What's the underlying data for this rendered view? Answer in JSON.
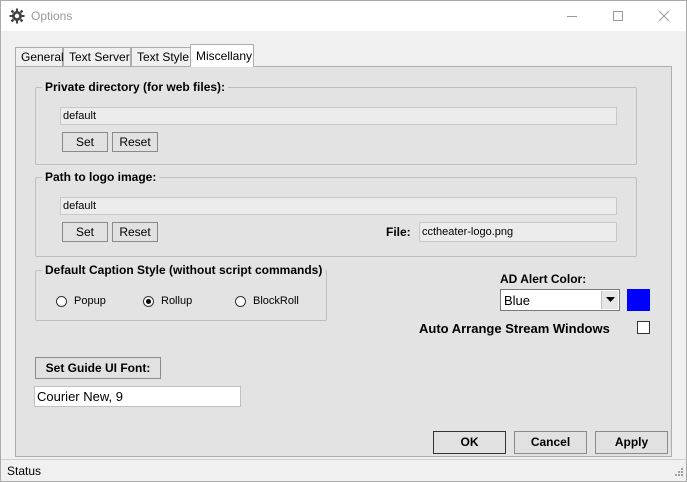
{
  "window": {
    "title": "Options",
    "accent": "#0000ff"
  },
  "tabs": [
    {
      "label": "General",
      "active": false
    },
    {
      "label": "Text Server",
      "active": false
    },
    {
      "label": "Text Style",
      "active": false
    },
    {
      "label": "Miscellany",
      "active": true
    }
  ],
  "private_dir": {
    "title": "Private directory (for web files):",
    "value": "default",
    "set_label": "Set",
    "reset_label": "Reset"
  },
  "logo": {
    "title": "Path to logo image:",
    "value": "default",
    "set_label": "Set",
    "reset_label": "Reset",
    "file_label": "File:",
    "file_value": "cctheater-logo.png"
  },
  "caption_style": {
    "title": "Default Caption Style (without script commands)",
    "options": [
      {
        "label": "Popup",
        "selected": false
      },
      {
        "label": "Rollup",
        "selected": true
      },
      {
        "label": "BlockRoll",
        "selected": false
      }
    ]
  },
  "ad_alert": {
    "label": "AD Alert Color:",
    "selected": "Blue",
    "swatch_color": "#0000ff"
  },
  "auto_arrange": {
    "label": "Auto Arrange Stream Windows",
    "checked": false
  },
  "guide_font": {
    "button_label": "Set Guide UI Font:",
    "value": "Courier New, 9"
  },
  "footer": {
    "ok_label": "OK",
    "cancel_label": "Cancel",
    "apply_label": "Apply"
  },
  "status": {
    "text": "Status"
  }
}
